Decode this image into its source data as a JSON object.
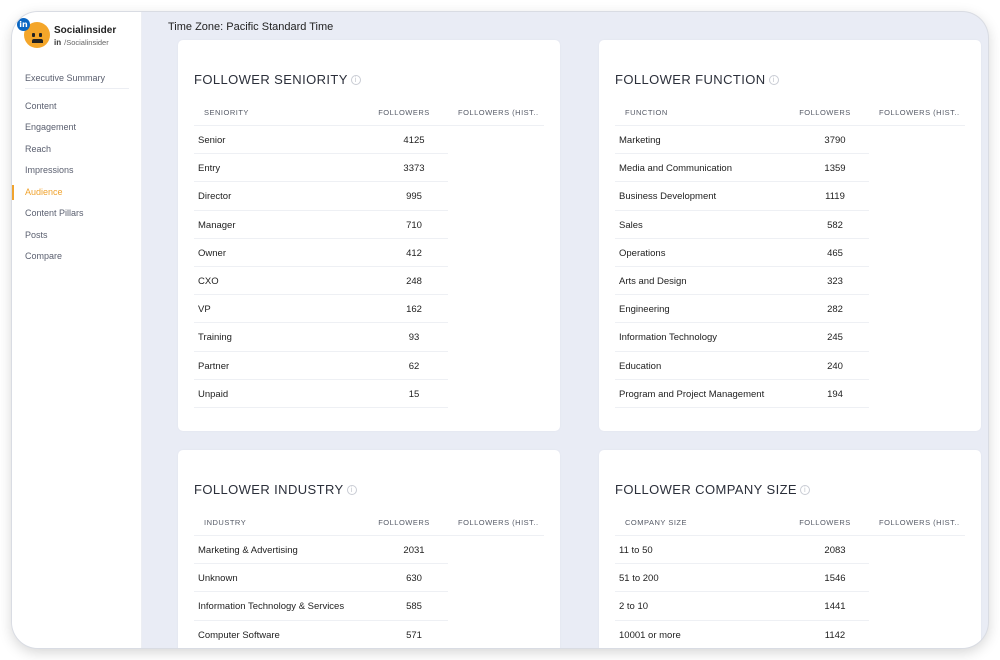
{
  "brand": {
    "name": "Socialinsider",
    "handle_prefix": "in",
    "handle": "/Socialinsider",
    "badge": "in"
  },
  "nav": {
    "items": [
      {
        "label": "Executive Summary",
        "active": false
      },
      {
        "label": "Content",
        "active": false
      },
      {
        "label": "Engagement",
        "active": false
      },
      {
        "label": "Reach",
        "active": false
      },
      {
        "label": "Impressions",
        "active": false
      },
      {
        "label": "Audience",
        "active": true
      },
      {
        "label": "Content Pillars",
        "active": false
      },
      {
        "label": "Posts",
        "active": false
      },
      {
        "label": "Compare",
        "active": false
      }
    ]
  },
  "timezone": "Time Zone: Pacific Standard Time",
  "colors": {
    "accent": "#f0a32e",
    "linkedin": "#0a66c2"
  },
  "cards": [
    {
      "title": "FOLLOWER SENIORITY",
      "columns": [
        "SENIORITY",
        "FOLLOWERS",
        "FOLLOWERS (HIST..."
      ],
      "rows": [
        [
          "Senior",
          "4125"
        ],
        [
          "Entry",
          "3373"
        ],
        [
          "Director",
          "995"
        ],
        [
          "Manager",
          "710"
        ],
        [
          "Owner",
          "412"
        ],
        [
          "CXO",
          "248"
        ],
        [
          "VP",
          "162"
        ],
        [
          "Training",
          "93"
        ],
        [
          "Partner",
          "62"
        ],
        [
          "Unpaid",
          "15"
        ]
      ]
    },
    {
      "title": "FOLLOWER FUNCTION",
      "columns": [
        "FUNCTION",
        "FOLLOWERS",
        "FOLLOWERS (HIST..."
      ],
      "rows": [
        [
          "Marketing",
          "3790"
        ],
        [
          "Media and Communication",
          "1359"
        ],
        [
          "Business Development",
          "1119"
        ],
        [
          "Sales",
          "582"
        ],
        [
          "Operations",
          "465"
        ],
        [
          "Arts and Design",
          "323"
        ],
        [
          "Engineering",
          "282"
        ],
        [
          "Information Technology",
          "245"
        ],
        [
          "Education",
          "240"
        ],
        [
          "Program and Project Management",
          "194"
        ]
      ]
    },
    {
      "title": "FOLLOWER INDUSTRY",
      "columns": [
        "INDUSTRY",
        "FOLLOWERS",
        "FOLLOWERS (HIST..."
      ],
      "rows": [
        [
          "Marketing & Advertising",
          "2031"
        ],
        [
          "Unknown",
          "630"
        ],
        [
          "Information Technology & Services",
          "585"
        ],
        [
          "Computer Software",
          "571"
        ]
      ]
    },
    {
      "title": "FOLLOWER COMPANY SIZE",
      "columns": [
        "COMPANY SIZE",
        "FOLLOWERS",
        "FOLLOWERS (HIST..."
      ],
      "rows": [
        [
          "11 to 50",
          "2083"
        ],
        [
          "51 to 200",
          "1546"
        ],
        [
          "2 to 10",
          "1441"
        ],
        [
          "10001 or more",
          "1142"
        ]
      ]
    }
  ]
}
